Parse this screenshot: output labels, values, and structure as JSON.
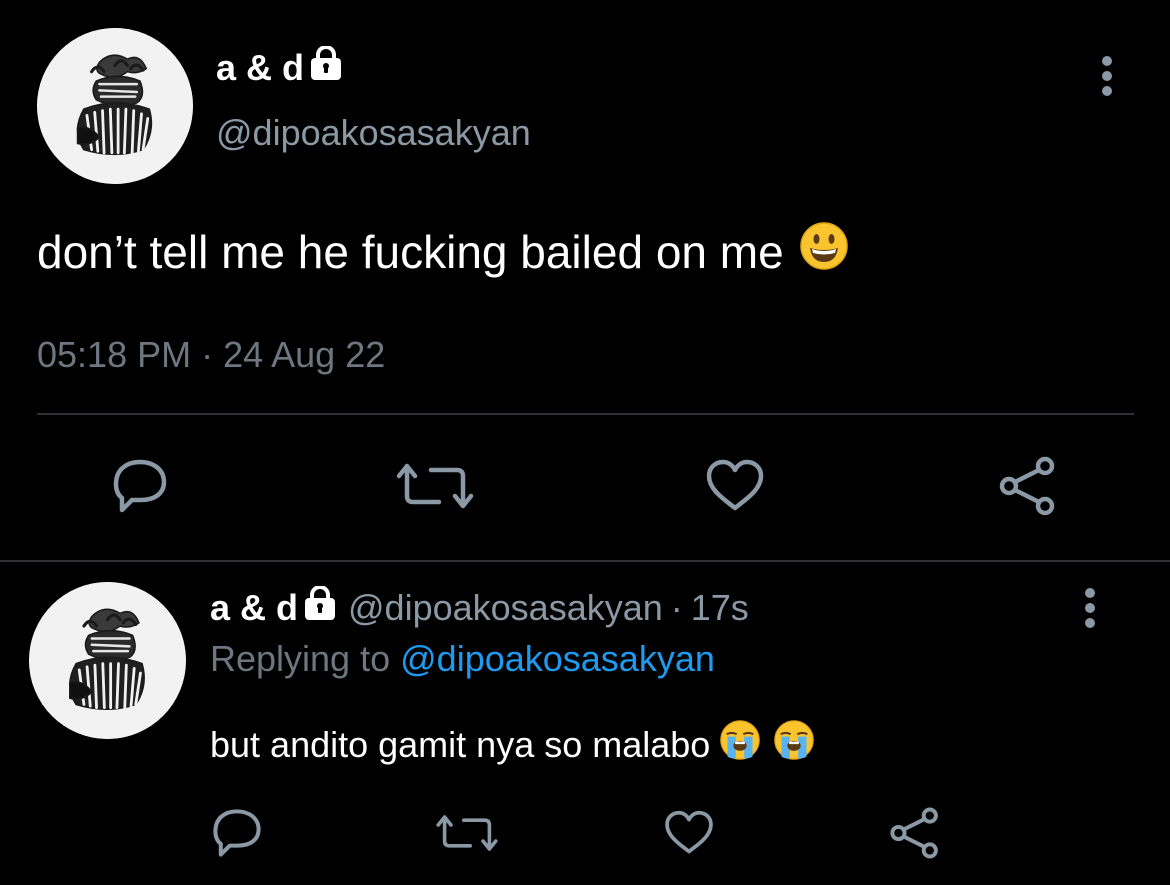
{
  "colors": {
    "background": "#000000",
    "text_primary": "#ffffff",
    "text_secondary": "#8b98a5",
    "timestamp": "#6e7781",
    "link": "#1d9bf0",
    "divider": "#2f3336",
    "icon": "#8b98a5"
  },
  "main_tweet": {
    "display_name": "a & d",
    "name_icon": "lock-icon",
    "handle": "@dipoakosasakyan",
    "text": "don’t tell me he fucking bailed on me",
    "text_emoji": "smiling-face-emoji",
    "timestamp": "05:18 PM · 24 Aug 22",
    "more_icon": "vertical-ellipsis-icon",
    "actions": [
      "reply-icon",
      "retweet-icon",
      "like-icon",
      "share-icon"
    ]
  },
  "reply_tweet": {
    "display_name": "a & d",
    "name_icon": "lock-icon",
    "handle": "@dipoakosasakyan",
    "separator": "·",
    "age": "17s",
    "replying_prefix": "Replying to",
    "replying_handle": "@dipoakosasakyan",
    "text": "but andito gamit nya so malabo",
    "text_emojis": [
      "loudly-crying-face-emoji",
      "loudly-crying-face-emoji"
    ],
    "more_icon": "vertical-ellipsis-icon",
    "actions": [
      "reply-icon",
      "retweet-icon",
      "like-icon",
      "share-icon"
    ]
  }
}
